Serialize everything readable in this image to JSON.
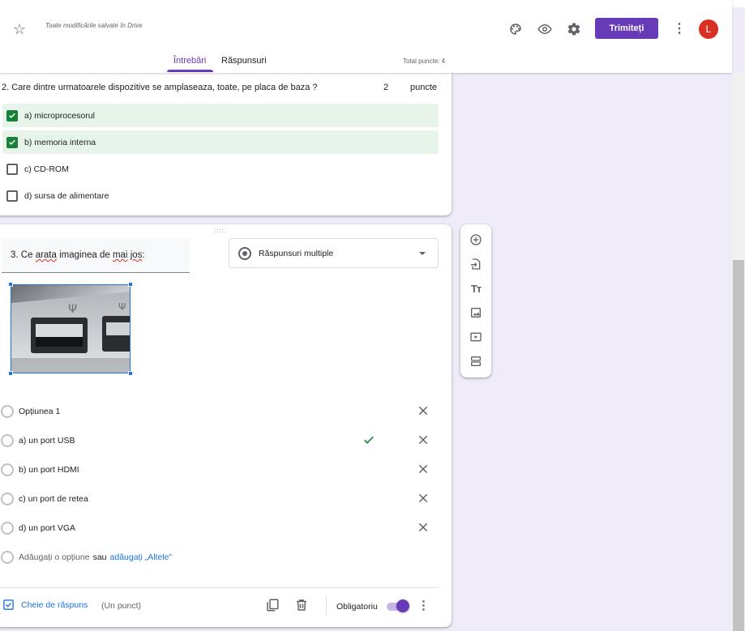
{
  "header": {
    "saved_status": "Toate modificările salvate în Drive",
    "send_label": "Trimiteți",
    "avatar_letter": "L",
    "tabs": [
      {
        "label": "Întrebări",
        "active": true
      },
      {
        "label": "Răspunsuri",
        "active": false
      }
    ],
    "total_points": "Total puncte: 4",
    "icons": [
      "star-icon",
      "palette-icon",
      "eye-icon",
      "settings-icon",
      "more-vert-icon"
    ]
  },
  "question2": {
    "title": "2. Care dintre urmatoarele dispozitive se amplaseaza, toate, pe placa de baza ?",
    "points_value": "2",
    "points_label": "puncte",
    "options": [
      {
        "label": "a) microprocesorul",
        "checked": true
      },
      {
        "label": "b) memoria interna",
        "checked": true
      },
      {
        "label": "c) CD-ROM",
        "checked": false
      },
      {
        "label": "d) sursa de alimentare",
        "checked": false
      }
    ]
  },
  "question3": {
    "title_prefix": "3. Ce ",
    "title_w1": "arata",
    "title_mid1": " imaginea de ",
    "title_w2": "mai",
    "title_sp": " ",
    "title_w3": "jos",
    "title_suffix": ":",
    "type_label": "Răspunsuri multiple",
    "image_desc": "usb-port-photo",
    "choices": [
      {
        "label": "Opțiunea 1",
        "correct": false
      },
      {
        "label": "a) un port USB",
        "correct": true
      },
      {
        "label": "b) un port HDMI",
        "correct": false
      },
      {
        "label": "c) un port de retea",
        "correct": false
      },
      {
        "label": "d) un port VGA",
        "correct": false
      }
    ],
    "add_option": "Adăugați o opțiune",
    "add_or": "sau",
    "add_other": "adăugați „Altele”",
    "answer_key": "Cheie de răspuns",
    "answer_points": "(Un punct)",
    "required_label": "Obligatoriu",
    "required_on": true
  },
  "side_toolbar": [
    "add-question-icon",
    "import-questions-icon",
    "add-title-icon",
    "add-image-icon",
    "add-video-icon",
    "add-section-icon"
  ],
  "colors": {
    "accent": "#673ab7",
    "background": "#f0ebf8",
    "correct_bg": "#e6f4ea",
    "check_green": "#188038",
    "link_blue": "#1a73e8",
    "avatar": "#d93025"
  }
}
